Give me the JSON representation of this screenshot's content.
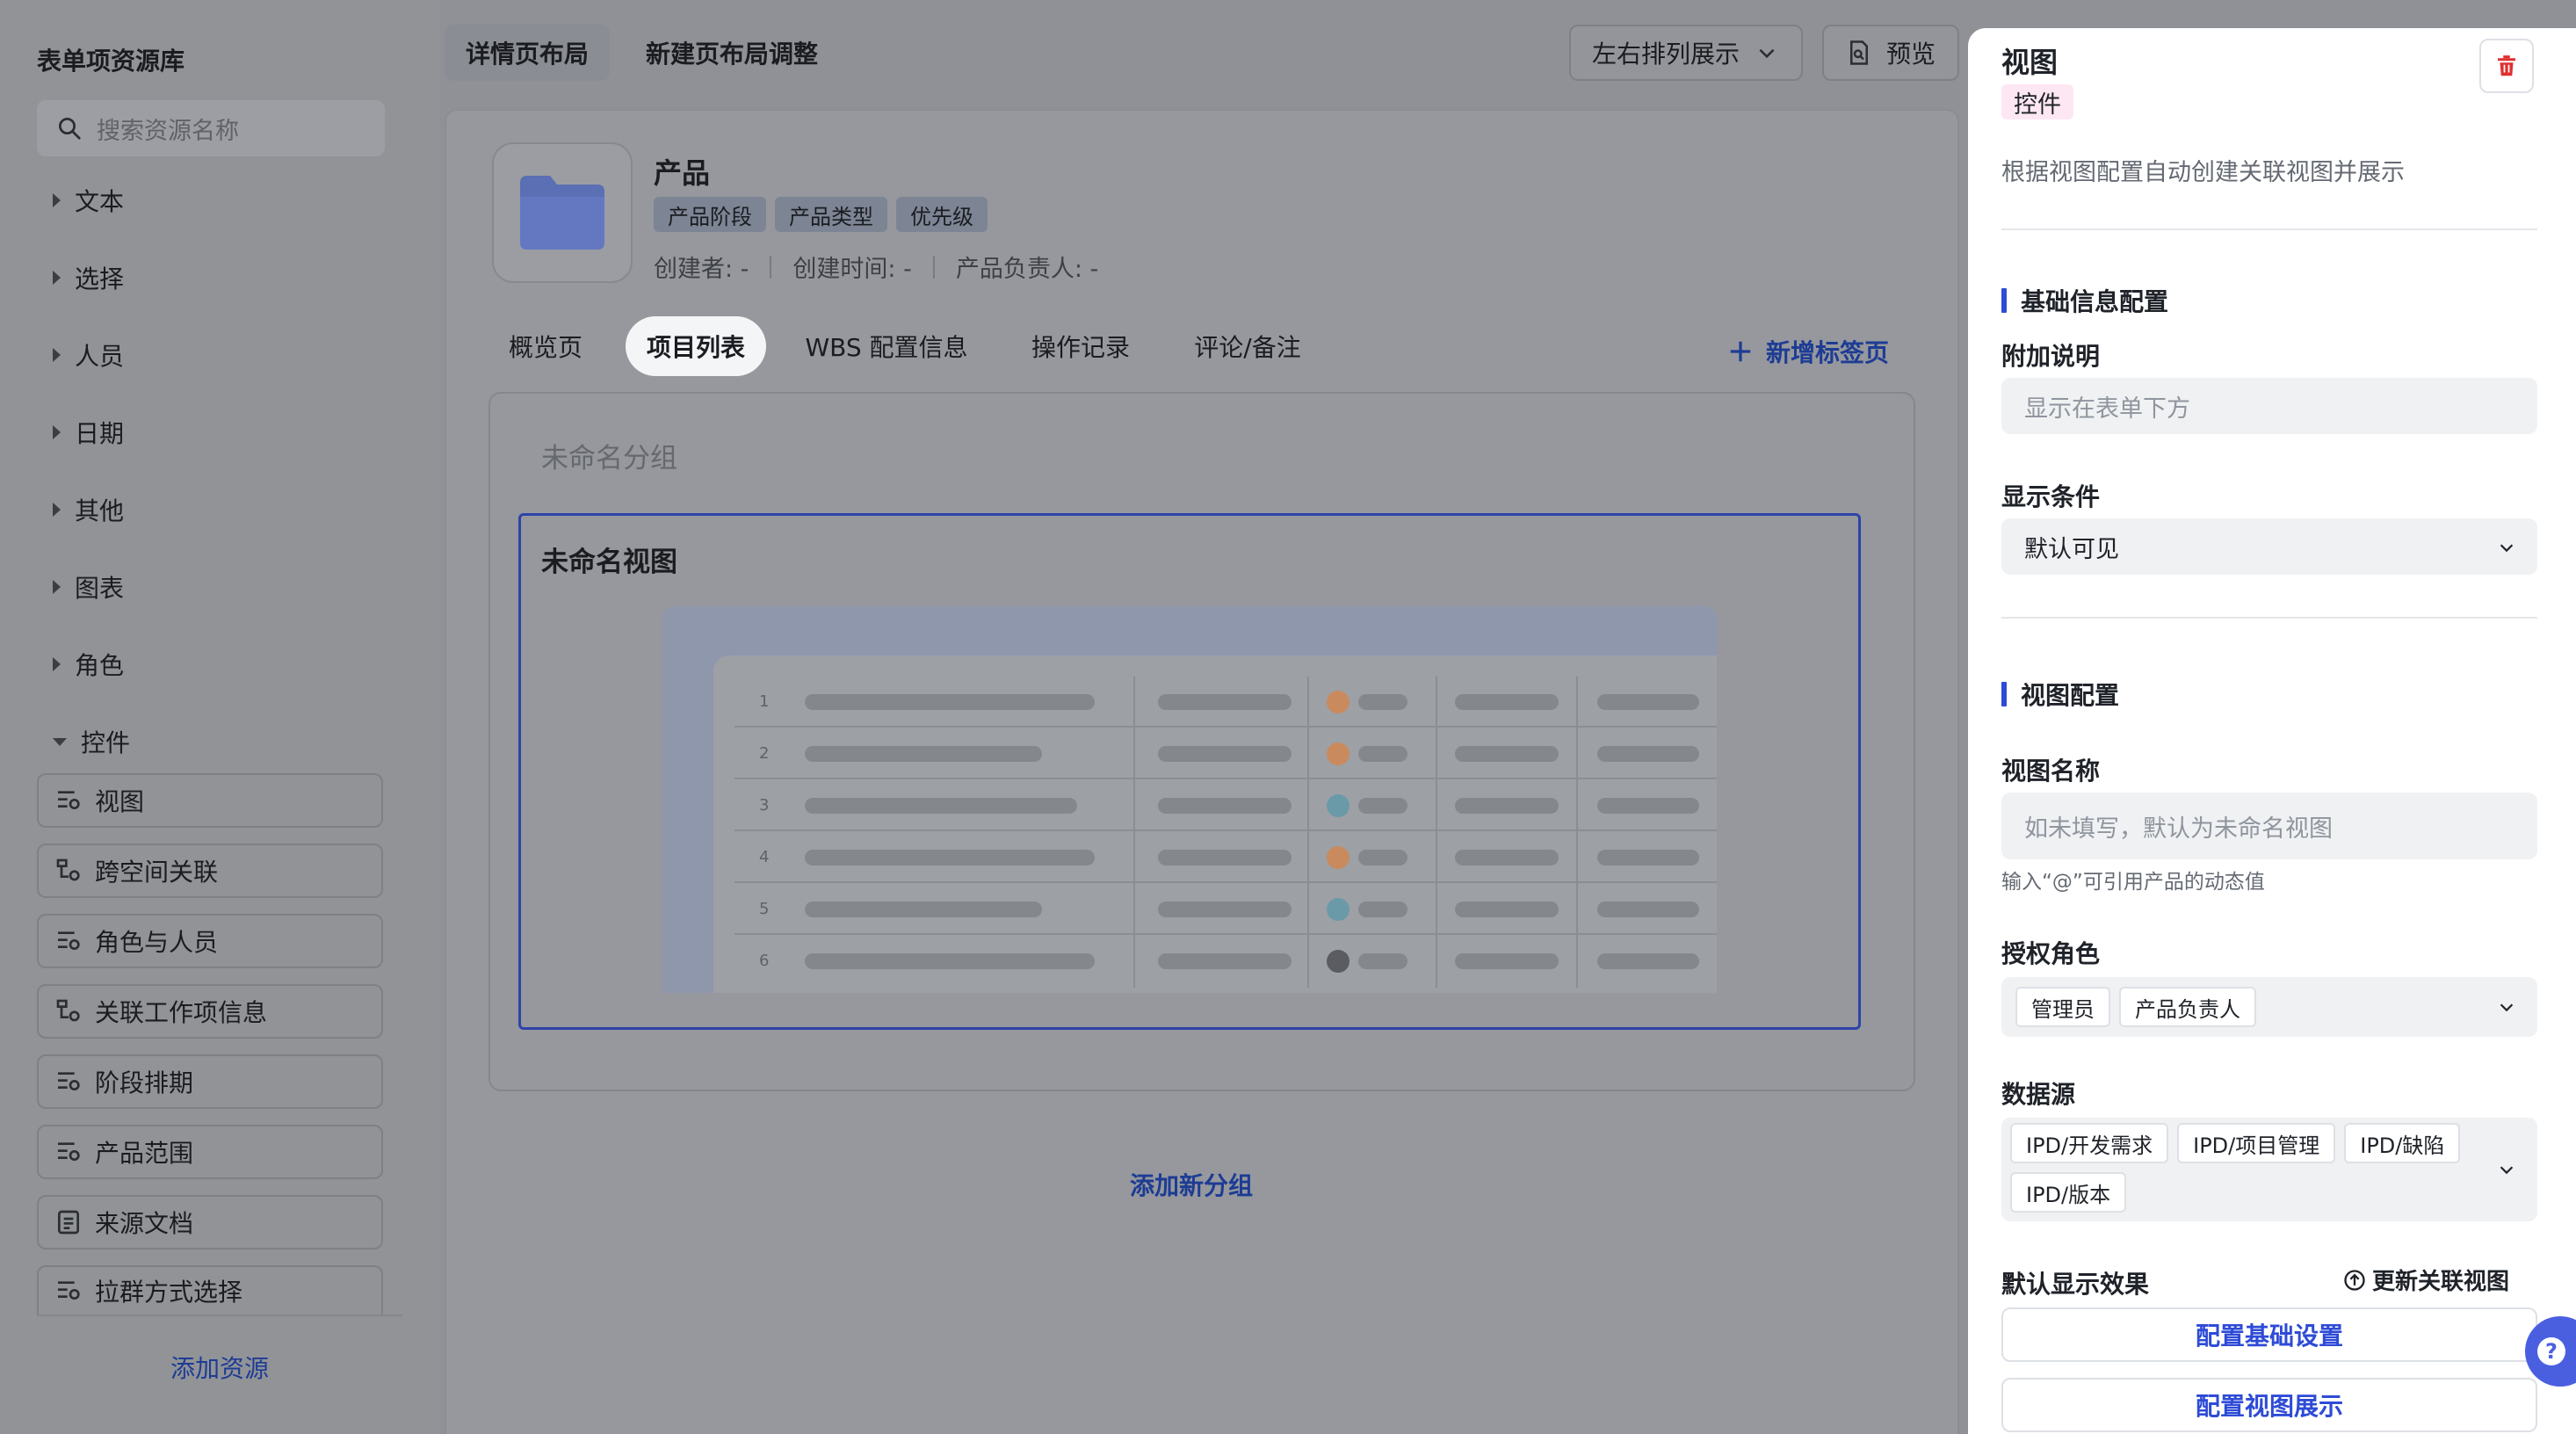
{
  "sidebar": {
    "title": "表单项资源库",
    "search_placeholder": "搜索资源名称",
    "categories": [
      {
        "label": "文本"
      },
      {
        "label": "选择"
      },
      {
        "label": "人员"
      },
      {
        "label": "日期"
      },
      {
        "label": "其他"
      },
      {
        "label": "图表"
      },
      {
        "label": "角色"
      },
      {
        "label": "控件"
      }
    ],
    "items": [
      {
        "label": "视图",
        "icon": "view-config-icon"
      },
      {
        "label": "跨空间关联",
        "icon": "tree-link-icon"
      },
      {
        "label": "角色与人员",
        "icon": "view-config-icon"
      },
      {
        "label": "关联工作项信息",
        "icon": "tree-link-icon"
      },
      {
        "label": "阶段排期",
        "icon": "view-config-icon"
      },
      {
        "label": "产品范围",
        "icon": "view-config-icon"
      },
      {
        "label": "来源文档",
        "icon": "document-icon"
      },
      {
        "label": "拉群方式选择",
        "icon": "view-config-icon"
      }
    ],
    "add_label": "添加资源"
  },
  "topbar": {
    "tab_detail": "详情页布局",
    "tab_new": "新建页布局调整",
    "layout_select": "左右排列展示",
    "preview": "预览"
  },
  "product": {
    "name": "产品",
    "tags": [
      "产品阶段",
      "产品类型",
      "优先级"
    ],
    "meta": [
      "创建者: -",
      "创建时间: -",
      "产品负责人: -"
    ]
  },
  "tabs": [
    {
      "label": "概览页"
    },
    {
      "label": "项目列表"
    },
    {
      "label": "WBS 配置信息"
    },
    {
      "label": "操作记录"
    },
    {
      "label": "评论/备注"
    }
  ],
  "add_tab": "新增标签页",
  "group": {
    "title": "未命名分组",
    "view_title": "未命名视图",
    "row_numbers": [
      "1",
      "2",
      "3",
      "4",
      "5",
      "6"
    ]
  },
  "add_group": "添加新分组",
  "panel": {
    "title": "视图",
    "badge": "控件",
    "description": "根据视图配置自动创建关联视图并展示",
    "section_basic": "基础信息配置",
    "extra_label": "附加说明",
    "extra_placeholder": "显示在表单下方",
    "condition_label": "显示条件",
    "condition_value": "默认可见",
    "section_view": "视图配置",
    "view_name_label": "视图名称",
    "view_name_placeholder": "如未填写，默认为未命名视图",
    "view_name_hint": "输入“@”可引用产品的动态值",
    "roles_label": "授权角色",
    "roles": [
      "管理员",
      "产品负责人"
    ],
    "datasource_label": "数据源",
    "datasources": [
      "IPD/开发需求",
      "IPD/项目管理",
      "IPD/缺陷",
      "IPD/版本"
    ],
    "default_display_label": "默认显示效果",
    "update_view": "更新关联视图",
    "btn_basic": "配置基础设置",
    "btn_view": "配置视图展示"
  },
  "colors": {
    "accent": "#2e4bd6",
    "link": "#1d3c94",
    "badge_bg": "#fde7f2",
    "delete": "#e03030"
  }
}
